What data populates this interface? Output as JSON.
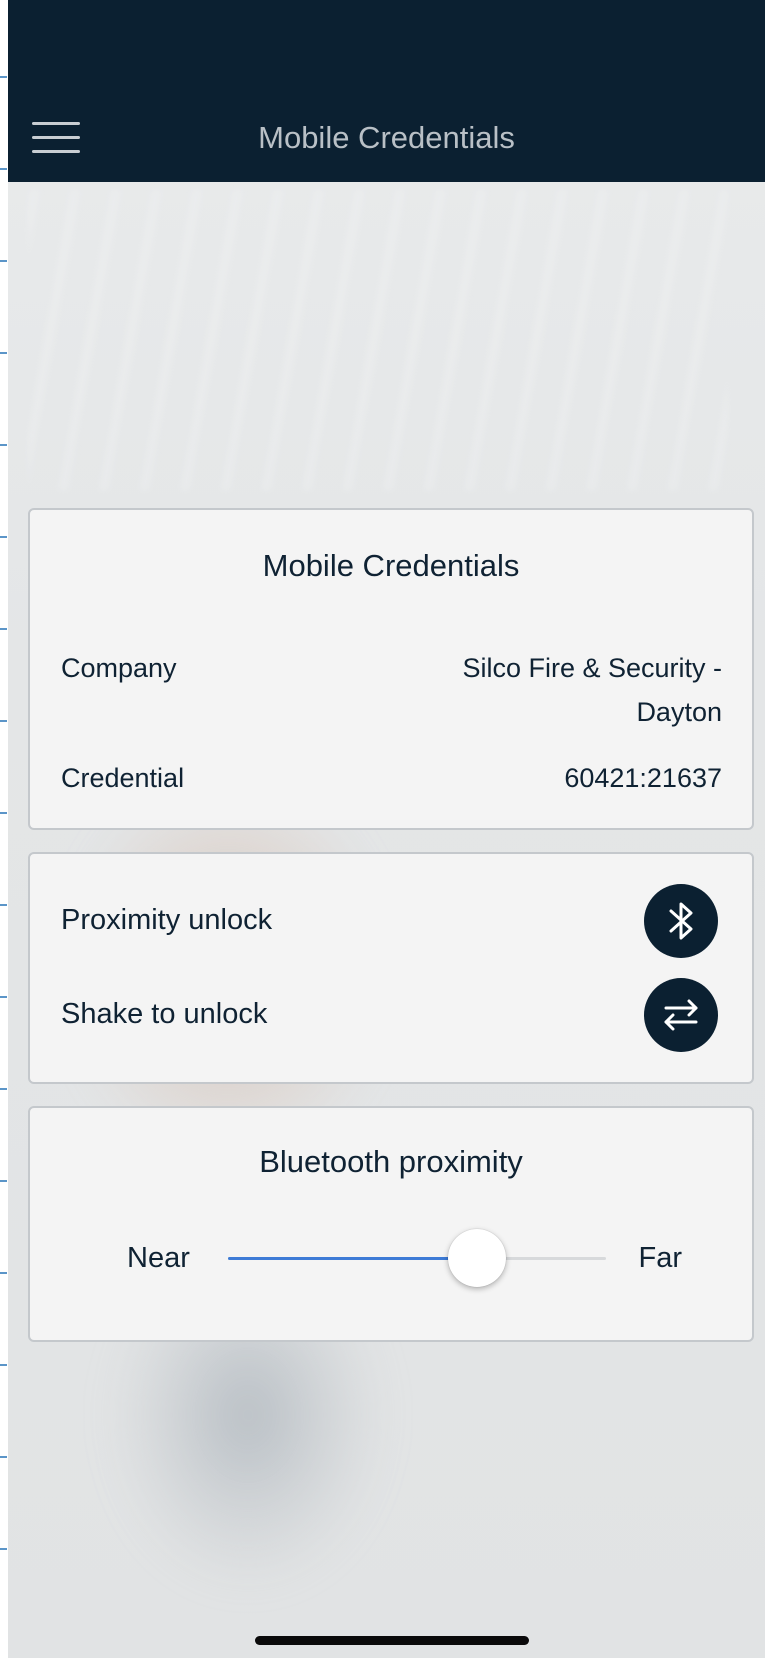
{
  "header": {
    "title": "Mobile Credentials",
    "menu_icon": "hamburger-menu-icon"
  },
  "credentials_card": {
    "title": "Mobile Credentials",
    "company_label": "Company",
    "company_value": "Silco Fire & Security - Dayton",
    "credential_label": "Credential",
    "credential_value": "60421:21637"
  },
  "unlock_card": {
    "proximity_label": "Proximity unlock",
    "proximity_icon": "bluetooth-icon",
    "shake_label": "Shake to unlock",
    "shake_icon": "swap-arrows-icon"
  },
  "proximity_card": {
    "title": "Bluetooth proximity",
    "min_label": "Near",
    "max_label": "Far",
    "level": 0.66
  },
  "colors": {
    "navbar": "#0b2031",
    "accent": "#3d7bd6",
    "card": "#f4f4f4",
    "text": "#0f2233"
  }
}
